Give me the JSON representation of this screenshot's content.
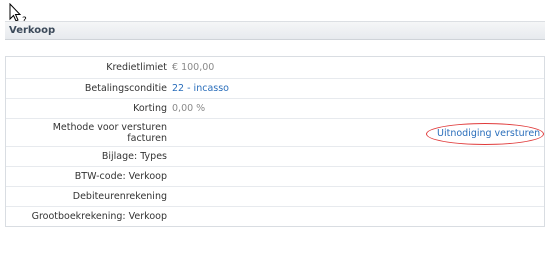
{
  "section": {
    "title": "Verkoop"
  },
  "fields": [
    {
      "label": "Kredietlimiet",
      "value": "€ 100,00"
    },
    {
      "label": "Betalingsconditie",
      "value": "22 - incasso"
    },
    {
      "label": "Korting",
      "value": "0,00 %"
    },
    {
      "label_line1": "Methode voor versturen",
      "label_line2": "facturen",
      "action": "Uitnodiging versturen"
    },
    {
      "label": "Bijlage: Types"
    },
    {
      "label": "BTW-code: Verkoop"
    },
    {
      "label": "Debiteurenrekening"
    },
    {
      "label": "Grootboekrekening: Verkoop"
    }
  ],
  "colors": {
    "link": "#2a6ebb",
    "annotation": "#e03a3a"
  }
}
